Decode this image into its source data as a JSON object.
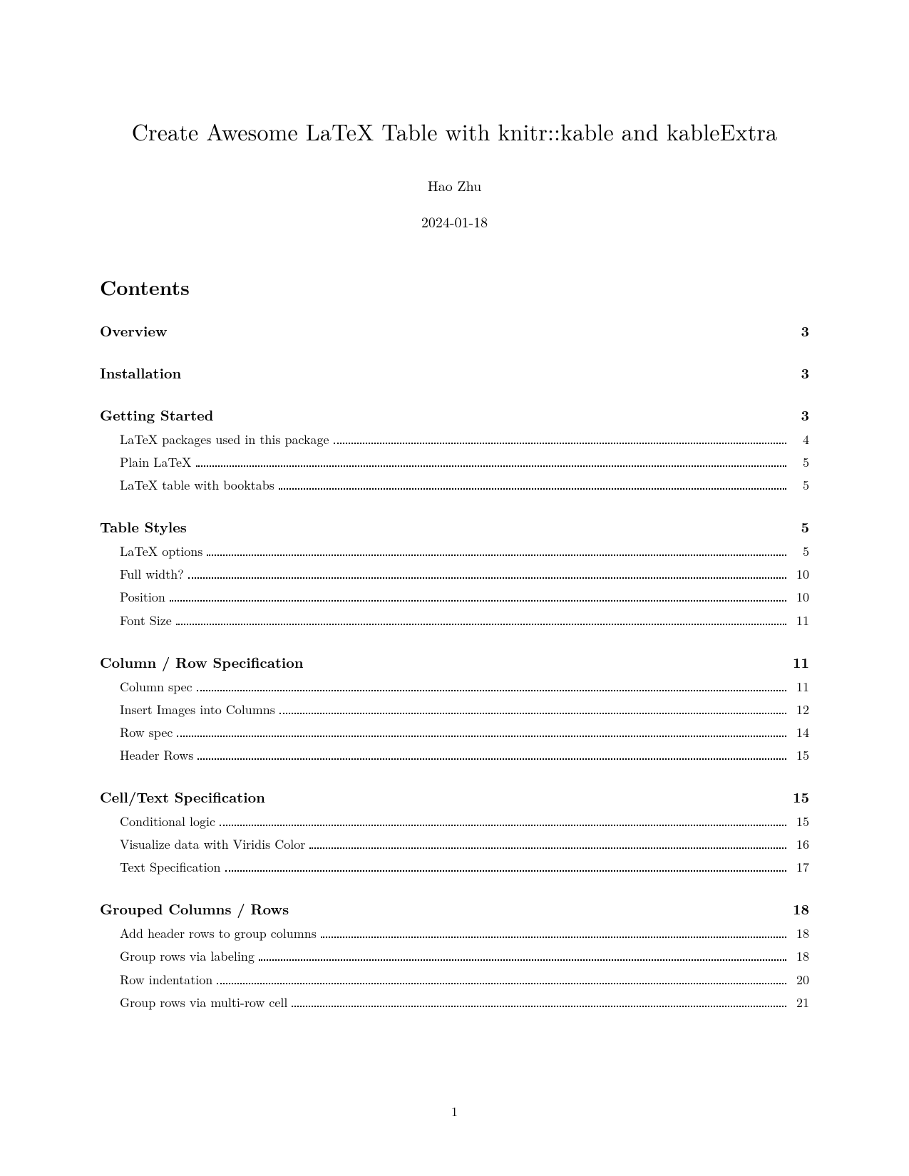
{
  "title": "Create Awesome LaTeX Table with knitr::kable and kableExtra",
  "author": "Hao Zhu",
  "date": "2024-01-18",
  "contents_heading": "Contents",
  "page_number": "1",
  "sections": [
    {
      "title": "Overview",
      "page": "3",
      "subs": []
    },
    {
      "title": "Installation",
      "page": "3",
      "subs": []
    },
    {
      "title": "Getting Started",
      "page": "3",
      "subs": [
        {
          "title": "LaTeX packages used in this package",
          "page": "4"
        },
        {
          "title": "Plain LaTeX",
          "page": "5"
        },
        {
          "title": "LaTeX table with booktabs",
          "page": "5"
        }
      ]
    },
    {
      "title": "Table Styles",
      "page": "5",
      "subs": [
        {
          "title": "LaTeX options",
          "page": "5"
        },
        {
          "title": "Full width?",
          "page": "10"
        },
        {
          "title": "Position",
          "page": "10"
        },
        {
          "title": "Font Size",
          "page": "11"
        }
      ]
    },
    {
      "title": "Column / Row Specification",
      "page": "11",
      "subs": [
        {
          "title": "Column spec",
          "page": "11"
        },
        {
          "title": "Insert Images into Columns",
          "page": "12"
        },
        {
          "title": "Row spec",
          "page": "14"
        },
        {
          "title": "Header Rows",
          "page": "15"
        }
      ]
    },
    {
      "title": "Cell/Text Specification",
      "page": "15",
      "subs": [
        {
          "title": "Conditional logic",
          "page": "15"
        },
        {
          "title": "Visualize data with Viridis Color",
          "page": "16"
        },
        {
          "title": "Text Specification",
          "page": "17"
        }
      ]
    },
    {
      "title": "Grouped Columns / Rows",
      "page": "18",
      "subs": [
        {
          "title": "Add header rows to group columns",
          "page": "18"
        },
        {
          "title": "Group rows via labeling",
          "page": "18"
        },
        {
          "title": "Row indentation",
          "page": "20"
        },
        {
          "title": "Group rows via multi-row cell",
          "page": "21"
        }
      ]
    }
  ]
}
